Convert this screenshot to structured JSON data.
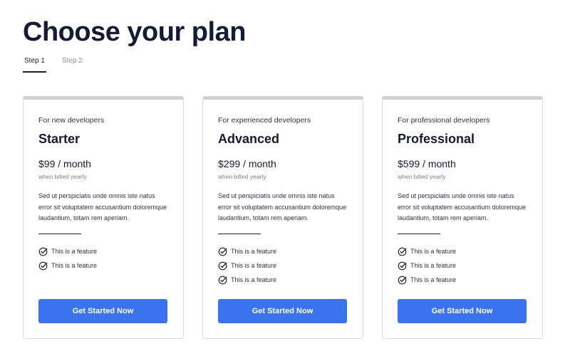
{
  "page": {
    "title": "Choose your plan"
  },
  "tabs": [
    {
      "label": "Step 1",
      "active": true
    },
    {
      "label": "Step 2",
      "active": false
    }
  ],
  "colors": {
    "accent": "#3b73ee",
    "heading": "#141b34",
    "card_top_border": "#d0d2d6"
  },
  "plans": [
    {
      "audience": "For new developers",
      "name": "Starter",
      "price": "$99 / month",
      "billing": "when billed yearly",
      "description": "Sed ut perspiciatis unde omnis iste natus error sit voluptatem accusantium doloremque laudantium, totam rem aperiam.",
      "features": [
        "This is a feature",
        "This is a feature"
      ],
      "cta": "Get Started Now"
    },
    {
      "audience": "For experienced developers",
      "name": "Advanced",
      "price": "$299 / month",
      "billing": "when billed yearly",
      "description": "Sed ut perspiciatis unde omnis iste natus error sit voluptatem accusantium doloremque laudantium, totam rem aperiam.",
      "features": [
        "This is a feature",
        "This is a feature",
        "This is a feature"
      ],
      "cta": "Get Started Now"
    },
    {
      "audience": "For professional developers",
      "name": "Professional",
      "price": "$599 / month",
      "billing": "when billed yearly",
      "description": "Sed ut perspiciatis unde omnis iste natus error sit voluptatem accusantium doloremque laudantium, totam rem aperiam.",
      "features": [
        "This is a feature",
        "This is a feature",
        "This is a feature"
      ],
      "cta": "Get Started Now"
    }
  ]
}
